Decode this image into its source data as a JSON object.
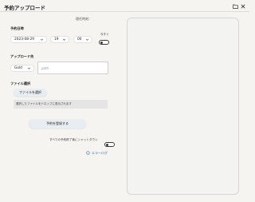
{
  "window": {
    "title": "予約アップロード"
  },
  "toolbar": {
    "folder_icon": "folder-icon",
    "close_icon": "close-icon"
  },
  "status": {
    "label": "理任時刻："
  },
  "schedule": {
    "section_label": "予約日時",
    "date": "2023-08-29",
    "hour": "19",
    "minute": "00",
    "now_label": "今すぐ"
  },
  "upload_target": {
    "section_label": "アップロード先",
    "service": "Gold",
    "path_placeholder": "path"
  },
  "file_select": {
    "section_label": "ファイル選択",
    "button_label": "ファイルを選択",
    "drop_hint": "選択したファイルをドロップに表示されます"
  },
  "actions": {
    "register_label": "予約を登録する",
    "shutdown_label": "すべての予約終了後にシャットダウン",
    "error_log_label": "エラーログ"
  },
  "colors": {
    "accent": "#2f6fa8",
    "background": "#f5f4f1"
  }
}
